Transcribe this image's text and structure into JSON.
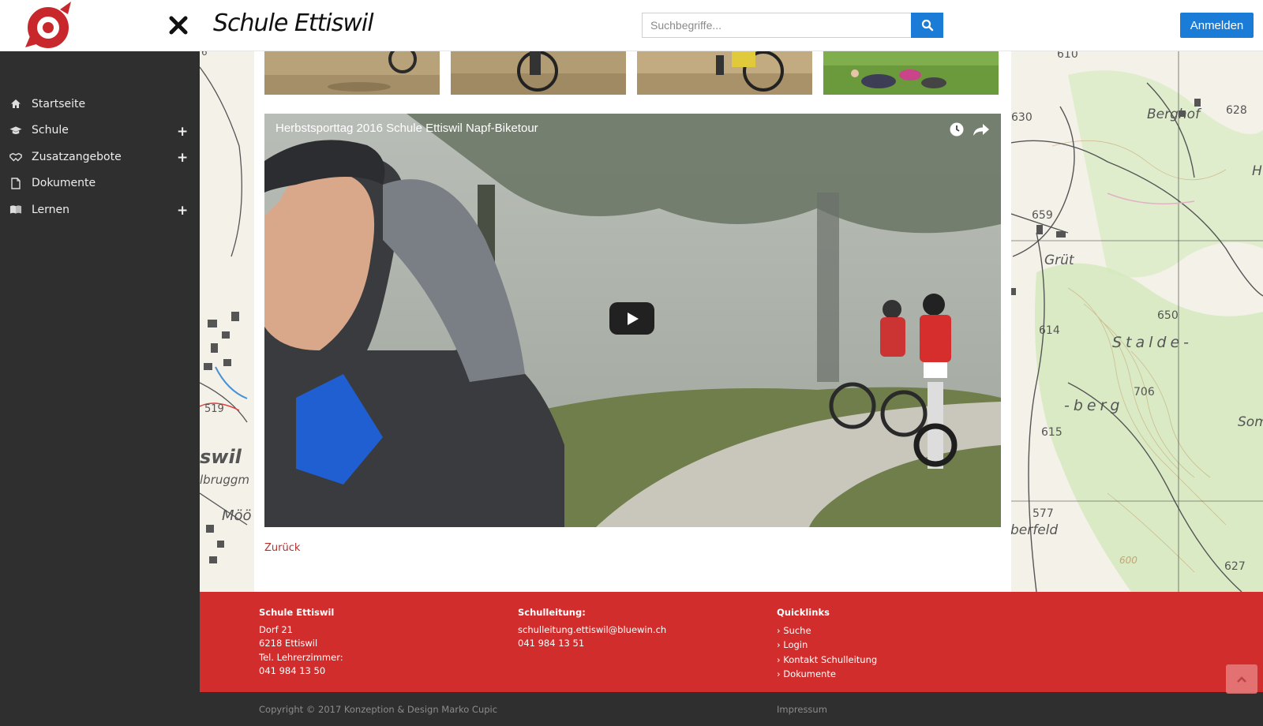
{
  "header": {
    "site_title": "Schule Ettiswil",
    "search_placeholder": "Suchbegriffe...",
    "login_label": "Anmelden",
    "accent_color": "#1a7cd6"
  },
  "sidebar": {
    "items": [
      {
        "label": "Startseite",
        "icon": "home-icon",
        "expandable": false
      },
      {
        "label": "Schule",
        "icon": "graduation-cap-icon",
        "expandable": true
      },
      {
        "label": "Zusatzangebote",
        "icon": "handshake-icon",
        "expandable": true
      },
      {
        "label": "Dokumente",
        "icon": "file-icon",
        "expandable": false
      },
      {
        "label": "Lernen",
        "icon": "book-icon",
        "expandable": true
      }
    ],
    "expand_symbol": "+"
  },
  "video": {
    "title": "Herbstsporttag 2016 Schule Ettiswil Napf-Biketour"
  },
  "content": {
    "back_label": "Zurück"
  },
  "map_labels": [
    "6",
    "610",
    "628",
    "Berghof",
    "630",
    "H",
    "659",
    "Grüt",
    "614",
    "650",
    "Stalde-",
    "706",
    "-berg",
    "519",
    "swil",
    "lbruggm",
    "615",
    "Som",
    "Möö",
    "577",
    "berfeld",
    "600",
    "627"
  ],
  "footer": {
    "col1": {
      "heading": "Schule Ettiswil",
      "lines": [
        "Dorf 21",
        "6218 Ettiswil",
        "Tel. Lehrerzimmer:",
        "041 984 13 50"
      ]
    },
    "col2": {
      "heading": "Schulleitung:",
      "email": "schulleitung.ettiswil@bluewin.ch",
      "phone": "041 984 13 51"
    },
    "col3": {
      "heading": "Quicklinks",
      "links": [
        "Suche",
        "Login",
        "Kontakt Schulleitung",
        "Dokumente"
      ]
    },
    "copyright": "Copyright © 2017 Konzeption & Design Marko Cupic",
    "impressum": "Impressum",
    "brand_color": "#d22d2d"
  }
}
